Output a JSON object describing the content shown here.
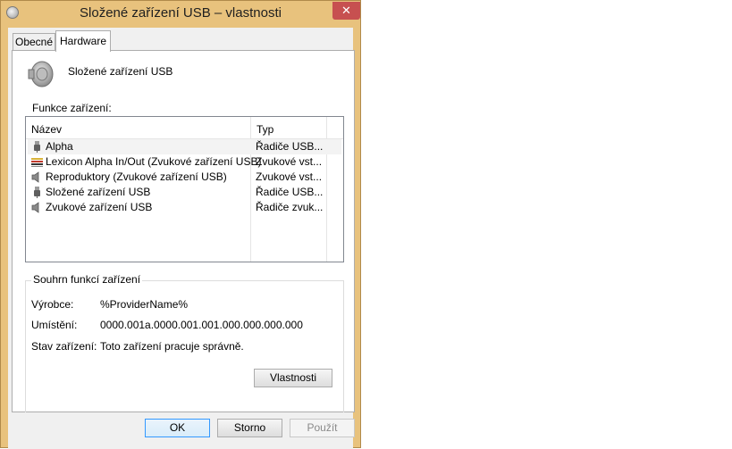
{
  "window": {
    "title": "Složené zařízení USB – vlastnosti",
    "close_label": "✕"
  },
  "tabs": [
    {
      "label": "Obecné"
    },
    {
      "label": "Hardware"
    }
  ],
  "device": {
    "name": "Složené zařízení USB",
    "icon": "speaker-icon"
  },
  "functions": {
    "label": "Funkce zařízení:",
    "columns": {
      "name": "Název",
      "type": "Typ"
    },
    "rows": [
      {
        "name": "Alpha",
        "type": "Řadiče USB...",
        "icon": "usb-plug-icon"
      },
      {
        "name": "Lexicon Alpha In/Out (Zvukové zařízení USB)",
        "type": "Zvukové vst...",
        "icon": "audio-jack-icon"
      },
      {
        "name": "Reproduktory (Zvukové zařízení USB)",
        "type": "Zvukové vst...",
        "icon": "speaker-icon"
      },
      {
        "name": "Složené zařízení USB",
        "type": "Řadiče USB...",
        "icon": "usb-plug-icon"
      },
      {
        "name": "Zvukové zařízení USB",
        "type": "Řadiče zvuk...",
        "icon": "speaker-icon"
      }
    ]
  },
  "summary": {
    "title": "Souhrn funkcí zařízení",
    "manufacturer_label": "Výrobce:",
    "manufacturer_value": "%ProviderName%",
    "location_label": "Umístění:",
    "location_value": "0000.001a.0000.001.001.000.000.000.000",
    "status_label": "Stav zařízení:",
    "status_value": "Toto zařízení pracuje správně.",
    "properties_button": "Vlastnosti"
  },
  "buttons": {
    "ok": "OK",
    "cancel": "Storno",
    "apply": "Použít"
  }
}
